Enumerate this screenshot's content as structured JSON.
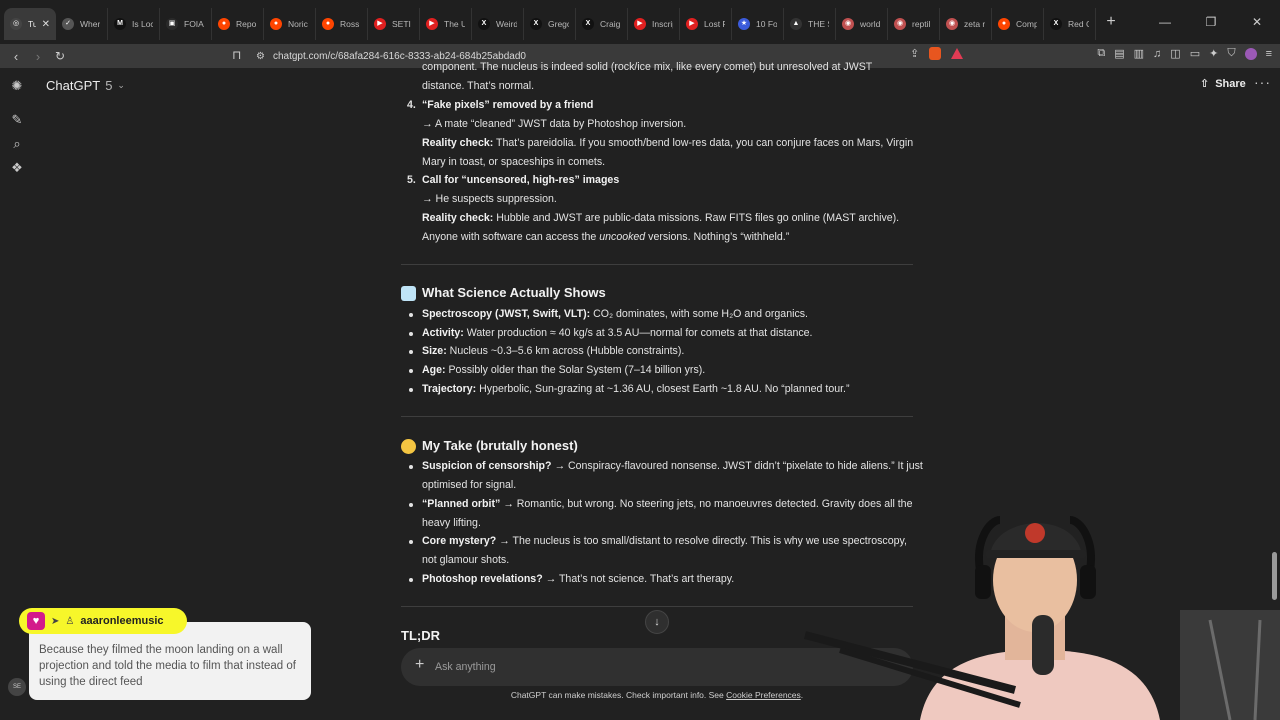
{
  "browser": {
    "tabs": [
      {
        "title": "Tu",
        "fav_color": "#444444",
        "glyph": "◎",
        "active": true
      },
      {
        "title": "Wher",
        "fav_color": "#555555",
        "glyph": "✓"
      },
      {
        "title": "Is Loc",
        "fav_color": "#111111",
        "glyph": "M"
      },
      {
        "title": "FOIA",
        "fav_color": "#2a2a2a",
        "glyph": "▣"
      },
      {
        "title": "Repo",
        "fav_color": "#ff4500",
        "glyph": "●"
      },
      {
        "title": "Noric",
        "fav_color": "#ff4500",
        "glyph": "●"
      },
      {
        "title": "Ross",
        "fav_color": "#ff4500",
        "glyph": "●"
      },
      {
        "title": "SETI",
        "fav_color": "#e02020",
        "glyph": "▶"
      },
      {
        "title": "The U",
        "fav_color": "#e02020",
        "glyph": "▶"
      },
      {
        "title": "Weird",
        "fav_color": "#111111",
        "glyph": "X"
      },
      {
        "title": "Grego",
        "fav_color": "#111111",
        "glyph": "X"
      },
      {
        "title": "Craig",
        "fav_color": "#111111",
        "glyph": "X"
      },
      {
        "title": "Inscrip",
        "fav_color": "#e02020",
        "glyph": "▶"
      },
      {
        "title": "Lost F",
        "fav_color": "#e02020",
        "glyph": "▶"
      },
      {
        "title": "10 Fo",
        "fav_color": "#3b5bdb",
        "glyph": "★"
      },
      {
        "title": "THE S",
        "fav_color": "#333333",
        "glyph": "▲"
      },
      {
        "title": "world",
        "fav_color": "#c05050",
        "glyph": "◉"
      },
      {
        "title": "reptil",
        "fav_color": "#c05050",
        "glyph": "◉"
      },
      {
        "title": "zeta r",
        "fav_color": "#c05050",
        "glyph": "◉"
      },
      {
        "title": "Comp",
        "fav_color": "#ff4500",
        "glyph": "●"
      },
      {
        "title": "Red C",
        "fav_color": "#111111",
        "glyph": "X"
      }
    ],
    "url": "chatgpt.com/c/68afa284-616c-8333-ab24-684b25abdad0"
  },
  "header": {
    "model_name": "ChatGPT",
    "model_version": "5",
    "share_label": "Share"
  },
  "chat": {
    "top_lines": [
      "component. The nucleus is indeed solid (rock/ice mix, like every comet) but unresolved at JWST",
      "distance. That’s normal."
    ],
    "item4": {
      "num": "4.",
      "title": "“Fake pixels” removed by a friend",
      "claim": "→ A mate “cleaned” JWST data by Photoshop inversion.",
      "check_label": "Reality check:",
      "check_1": " That’s pareidolia. If you smooth/bend low-res data, you can conjure faces on Mars, Virgin",
      "check_2": "Mary in toast, or spaceships in comets."
    },
    "item5": {
      "num": "5.",
      "title": "Call for “uncensored, high-res” images",
      "claim": "→ He suspects suppression.",
      "check_label": "Reality check:",
      "check_1": " Hubble and JWST are public-data missions. Raw FITS files go online (MAST archive).",
      "check_2a": "Anyone with software can access the ",
      "check_2_em": "uncooked",
      "check_2b": " versions. Nothing’s “withheld.”"
    },
    "science": {
      "heading": "What Science Actually Shows",
      "bullets": [
        {
          "label": "Spectroscopy (JWST, Swift, VLT):",
          "text": " CO₂ dominates, with some H₂O and organics."
        },
        {
          "label": "Activity:",
          "text": " Water production ≈ 40 kg/s at 3.5 AU—normal for comets at that distance."
        },
        {
          "label": "Size:",
          "text": " Nucleus ~0.3–5.6 km across (Hubble constraints)."
        },
        {
          "label": "Age:",
          "text": " Possibly older than the Solar System (7–14 billion yrs)."
        },
        {
          "label": "Trajectory:",
          "text": " Hyperbolic, Sun-grazing at ~1.36 AU, closest Earth ~1.8 AU. No “planned tour.”"
        }
      ]
    },
    "take": {
      "heading": "My Take (brutally honest)",
      "b1_label": "Suspicion of censorship?",
      "b1_text": " → Conspiracy-flavoured nonsense. JWST didn’t “pixelate to hide aliens.” It just",
      "b1_cont": "optimised for signal.",
      "b2_label": "“Planned orbit”",
      "b2_text": " → Romantic, but wrong. No steering jets, no manoeuvres detected. Gravity does all the",
      "b2_cont": "heavy lifting.",
      "b3_label": "Core mystery?",
      "b3_text": " → The nucleus is too small/distant to resolve directly. This is why we use spectroscopy,",
      "b3_cont": "not glamour shots.",
      "b4_label": "Photoshop revelations?",
      "b4_text": " → That’s not science. That’s art therapy."
    },
    "tldr": "TL;DR"
  },
  "composer": {
    "placeholder": "Ask anything",
    "disclaimer": "ChatGPT can make mistakes. Check important info. See ",
    "disclaimer_link": "Cookie Preferences",
    "disclaimer_end": "."
  },
  "overlay": {
    "username": "aaaronleemusic",
    "message": "Because they filmed the moon landing on a wall projection and told the media to film that instead of using the direct feed",
    "avatar_text": "SE"
  },
  "colors": {
    "background": "#212121",
    "overlay_name_bg": "#f7f72a",
    "overlay_msg_bg": "#f2f2f2",
    "heart": "#d31a8b"
  }
}
